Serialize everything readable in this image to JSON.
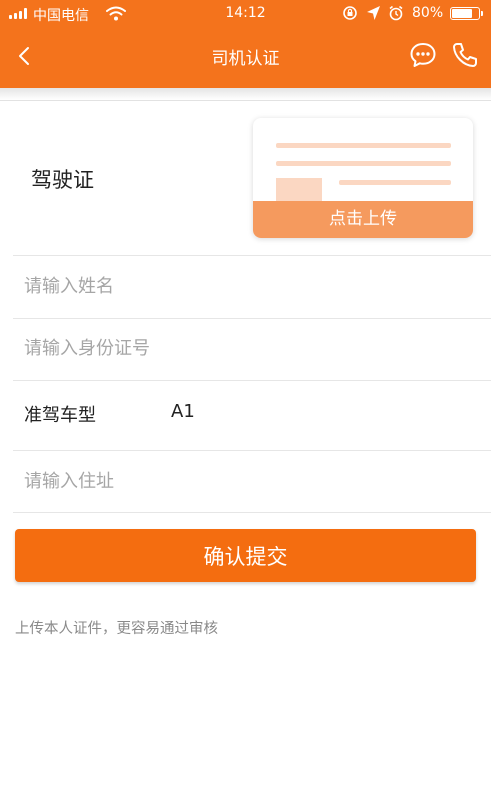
{
  "status_bar": {
    "carrier": "中国电信",
    "time": "14:12",
    "battery_percent": "80%",
    "battery_level": 0.8
  },
  "nav": {
    "title": "司机认证",
    "back_icon": "chevron-left-icon",
    "chat_icon": "chat-bubble-icon",
    "phone_icon": "phone-icon"
  },
  "license": {
    "label": "驾驶证",
    "upload_label": "点击上传"
  },
  "form": {
    "name_placeholder": "请输入姓名",
    "id_placeholder": "请输入身份证号",
    "vehicle_class_label": "准驾车型",
    "vehicle_class_value": "A1",
    "address_placeholder": "请输入住址"
  },
  "submit_label": "确认提交",
  "hint": "上传本人证件，更容易通过审核",
  "colors": {
    "accent": "#f46d10",
    "header": "#f4731c",
    "upload_banner": "#f59a5e",
    "card_placeholder": "#fbd7c2"
  }
}
